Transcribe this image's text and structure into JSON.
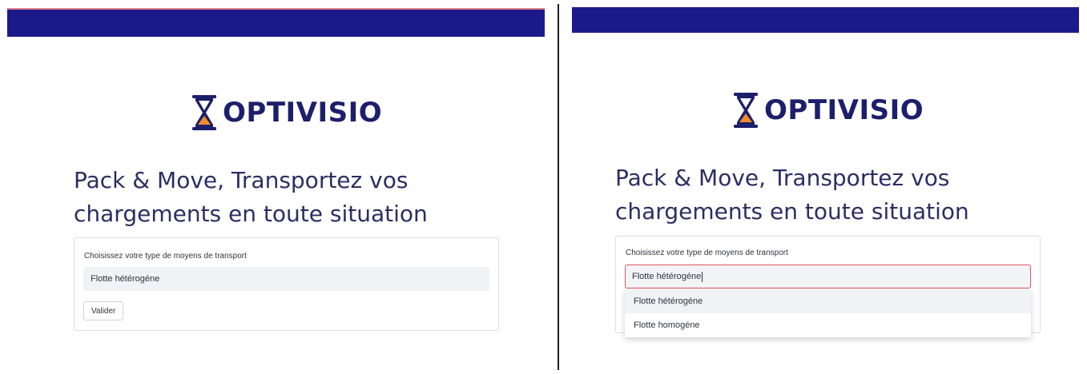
{
  "brand": {
    "name": "OPTIVISIO"
  },
  "colors": {
    "topbar": "#1c1a8a",
    "logo_orange": "#f28c28",
    "text_dark": "#2b2e63",
    "focus_border": "#e2565e"
  },
  "heading": {
    "line1": "Pack & Move, Transportez vos",
    "line2": "chargements en toute situation"
  },
  "form": {
    "label": "Choisissez votre type de moyens de transport",
    "selected_value": "Flotte hétérogéne",
    "submit_label": "Valider",
    "options": [
      "Flotte hétérogéne",
      "Flotte homogéne"
    ]
  }
}
